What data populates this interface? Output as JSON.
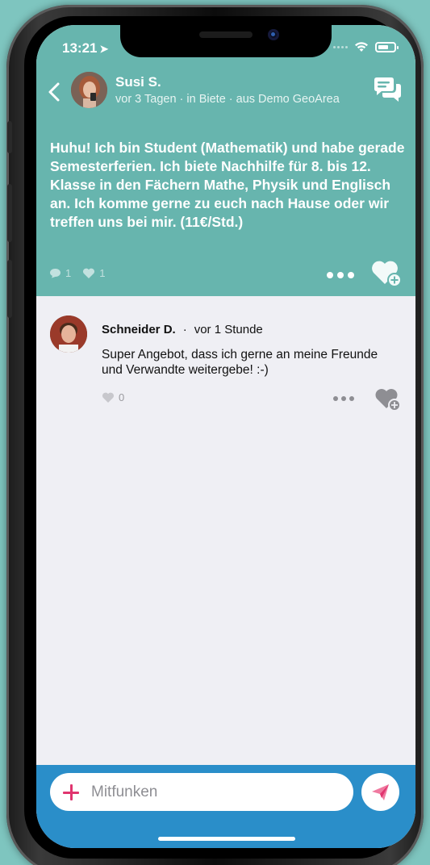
{
  "status_bar": {
    "time": "13:21"
  },
  "post": {
    "author": "Susi S.",
    "meta": "vor 3 Tagen · in Biete · aus Demo GeoArea",
    "text": "Huhu! Ich bin Student (Mathematik) und habe gerade Semesterferien. Ich biete Nachhilfe für 8. bis 12. Klasse in den Fächern Mathe, Physik und Englisch an. Ich komme gerne zu euch nach Hause oder wir treffen uns bei mir. (11€/Std.)",
    "comment_count": "1",
    "like_count": "1"
  },
  "comments": [
    {
      "author": "Schneider D.",
      "separator": "·",
      "time": "vor 1 Stunde",
      "text": "Super Angebot, dass ich gerne an meine Freunde und Verwandte weitergebe! :-)",
      "like_count": "0"
    }
  ],
  "composer": {
    "placeholder": "Mitfunken"
  },
  "colors": {
    "teal_header": "#67b5ae",
    "blue_bar": "#2a8ec9",
    "accent_pink": "#e0356f",
    "content_bg": "#efeff4"
  }
}
